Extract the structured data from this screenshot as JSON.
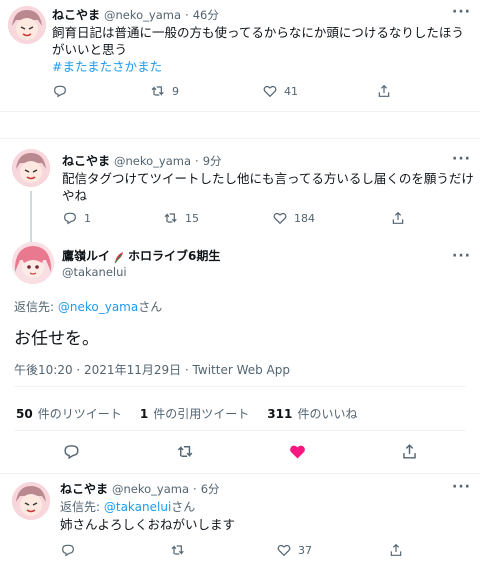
{
  "tweet1": {
    "name": "ねこやま",
    "handle": "@neko_yama",
    "time": "46分",
    "text_line1": "飼育日記は普通に一般の方も使ってるからなにか頭につけるなりしたほう",
    "text_line2": "がいいと思う",
    "hashtag": "#またまたさかまた",
    "replies": "",
    "retweets": "9",
    "likes": "41"
  },
  "tweet2": {
    "name": "ねこやま",
    "handle": "@neko_yama",
    "time": "9分",
    "text_line1": "配信タグつけてツイートしたし他にも言ってる方いるし届くのを願うだけ",
    "text_line2": "やね",
    "replies": "1",
    "retweets": "15",
    "likes": "184"
  },
  "main_tweet": {
    "name": "鷹嶺ルイ",
    "name_suffix": "ホロライブ6期生",
    "handle": "@takanelui",
    "reply_prefix": "返信先: ",
    "reply_to": "@neko_yama",
    "reply_suffix": "さん",
    "text": "お任せを。",
    "timestamp": "午後10:20 · 2021年11月29日 · Twitter Web App",
    "stats": {
      "retweets_num": "50",
      "retweets_label": "件のリツイート",
      "quotes_num": "1",
      "quotes_label": "件の引用ツイート",
      "likes_num": "311",
      "likes_label": "件のいいね"
    },
    "like_color": "#f91880"
  },
  "tweet3": {
    "name": "ねこやま",
    "handle": "@neko_yama",
    "time": "6分",
    "reply_prefix": "返信先: ",
    "reply_to": "@takanelui",
    "reply_suffix": "さん",
    "text": "姉さんよろしくおねがいします",
    "replies": "",
    "retweets": "",
    "likes": "37"
  },
  "icons": {
    "reply": "reply-icon",
    "retweet": "retweet-icon",
    "like": "heart-icon",
    "share": "share-icon",
    "more": "more-icon"
  },
  "more_glyph": "···",
  "sep": "·"
}
